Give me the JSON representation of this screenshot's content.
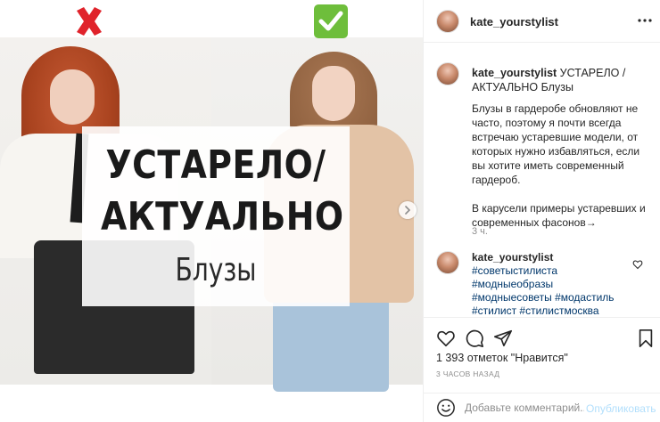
{
  "post": {
    "image": {
      "overlay_line1": "УСТАРЕЛО/",
      "overlay_line2": "АКТУАЛЬНО",
      "overlay_subtitle": "Блузы",
      "left_mark_icon": "red-cross-mark",
      "right_mark_icon": "green-check-mark",
      "next_icon": "chevron-right-icon"
    },
    "header": {
      "username": "kate_yourstylist",
      "more_icon": "more-horizontal-icon"
    },
    "caption": {
      "username": "kate_yourstylist",
      "title": "УСТАРЕЛО / АКТУАЛЬНО Блузы",
      "paragraph1": "Блузы в гардеробе обновляют не часто, поэтому я почти всегда встречаю устаревшие модели, от которых нужно избавляться, если вы хотите иметь современный гардероб.",
      "paragraph2": "В карусели примеры устаревших и современных фасонов→",
      "time": "3 ч."
    },
    "comment": {
      "username": "kate_yourstylist",
      "hashtags": [
        "#советыстилиста",
        "#модныеобразы",
        "#модныесоветы",
        "#модастиль",
        "#стилист",
        "#стилистмосква"
      ]
    },
    "actions": {
      "likes_count": "1 393",
      "likes_suffix": "отметок",
      "likes_link": "\"Нравится\"",
      "date": "3 ЧАСОВ НАЗАД"
    },
    "add_comment": {
      "placeholder": "Добавьте комментарий...",
      "post_label": "Опубликовать"
    }
  },
  "colors": {
    "link": "#00376b",
    "muted": "#8e8e8e",
    "post_button": "#b2dffc",
    "cross": "#e0232b",
    "check": "#6ebe3b"
  }
}
